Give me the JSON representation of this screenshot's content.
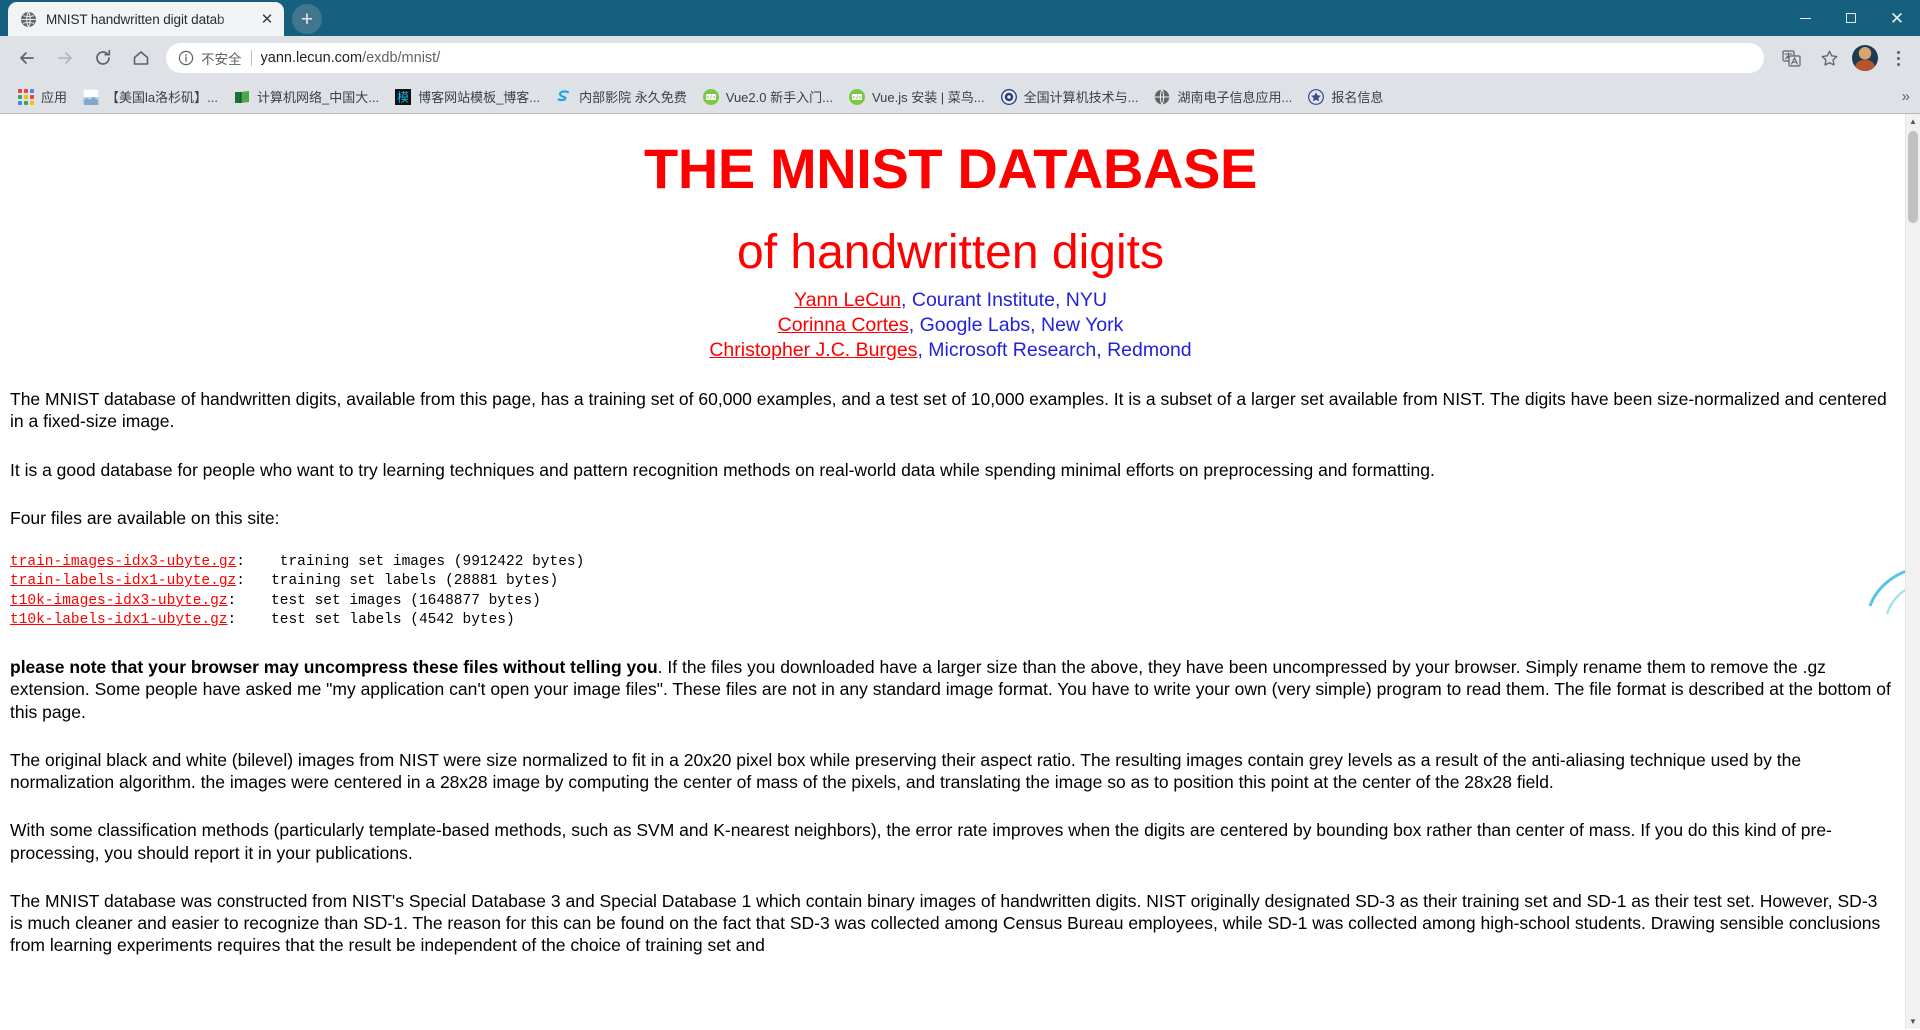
{
  "window": {
    "minimize_label": "Minimize",
    "maximize_label": "Maximize",
    "close_label": "Close"
  },
  "tab": {
    "title": "MNIST handwritten digit datab",
    "favicon_name": "globe-icon",
    "close_label": "✕",
    "newtab_label": "+"
  },
  "toolbar": {
    "back_label": "←",
    "forward_label": "→",
    "reload_label": "⟳",
    "home_label": "⌂",
    "security_text": "不安全",
    "url_prefix": "yann.lecun.com",
    "url_suffix": "/exdb/mnist/",
    "translate_label": "translate-icon",
    "bookmark_star_label": "☆",
    "menu_label": "⋮"
  },
  "bookmarks": {
    "apps_label": "应用",
    "overflow_label": "»",
    "items": [
      {
        "label": "【美国la洛杉矶】...",
        "icon": "photo-icon",
        "color": "#cfe2f3"
      },
      {
        "label": "计算机网络_中国大...",
        "icon": "book-icon",
        "color": "#2f9e44"
      },
      {
        "label": "博客网站模板_博客...",
        "icon": "mo-icon",
        "color": "#14a0d6"
      },
      {
        "label": "内部影院 永久免费",
        "icon": "s-icon",
        "color": "#1aa3e8"
      },
      {
        "label": "Vue2.0 新手入门...",
        "icon": "code-icon",
        "color": "#7ac943"
      },
      {
        "label": "Vue.js 安装 | 菜鸟...",
        "icon": "code-icon",
        "color": "#7ac943"
      },
      {
        "label": "全国计算机技术与...",
        "icon": "seal-icon",
        "color": "#1f3a93"
      },
      {
        "label": "湖南电子信息应用...",
        "icon": "globe-icon",
        "color": "#5f6368"
      },
      {
        "label": "报名信息",
        "icon": "emblem-icon",
        "color": "#3b4a8c"
      }
    ]
  },
  "content": {
    "title": "THE MNIST DATABASE",
    "subtitle": "of handwritten digits",
    "authors": [
      {
        "name": "Yann LeCun",
        "affiliation": ", Courant Institute, NYU",
        "link": true
      },
      {
        "name": "Corinna Cortes",
        "affiliation": ", Google Labs, New York",
        "link": true
      },
      {
        "name": "Christopher J.C. Burges",
        "affiliation": ", Microsoft Research, Redmond",
        "link": true
      }
    ],
    "paragraphs": [
      "The MNIST database of handwritten digits, available from this page, has a training set of 60,000 examples, and a test set of 10,000 examples. It is a subset of a larger set available from NIST. The digits have been size-normalized and centered in a fixed-size image.",
      "It is a good database for people who want to try learning techniques and pattern recognition methods on real-world data while spending minimal efforts on preprocessing and formatting.",
      "Four files are available on this site:"
    ],
    "files": [
      {
        "name": "train-images-idx3-ubyte.gz",
        "desc": "training set images (9912422 bytes)"
      },
      {
        "name": "train-labels-idx1-ubyte.gz",
        "desc": "training set labels (28881 bytes)"
      },
      {
        "name": "t10k-images-idx3-ubyte.gz",
        "desc": " test set images (1648877 bytes)"
      },
      {
        "name": "t10k-labels-idx1-ubyte.gz",
        "desc": " test set labels (4542 bytes)"
      }
    ],
    "note_bold": "please note that your browser may uncompress these files without telling you",
    "note_rest": ". If the files you downloaded have a larger size than the above, they have been uncompressed by your browser. Simply rename them to remove the .gz extension. Some people have asked me \"my application can't open your image files\". These files are not in any standard image format. You have to write your own (very simple) program to read them. The file format is described at the bottom of this page.",
    "paragraphs2": [
      "The original black and white (bilevel) images from NIST were size normalized to fit in a 20x20 pixel box while preserving their aspect ratio. The resulting images contain grey levels as a result of the anti-aliasing technique used by the normalization algorithm. the images were centered in a 28x28 image by computing the center of mass of the pixels, and translating the image so as to position this point at the center of the 28x28 field.",
      "With some classification methods (particularly template-based methods, such as SVM and K-nearest neighbors), the error rate improves when the digits are centered by bounding box rather than center of mass. If you do this kind of pre-processing, you should report it in your publications.",
      "The MNIST database was constructed from NIST's Special Database 3 and Special Database 1 which contain binary images of handwritten digits. NIST originally designated SD-3 as their training set and SD-1 as their test set. However, SD-3 is much cleaner and easier to recognize than SD-1. The reason for this can be found on the fact that SD-3 was collected among Census Bureau employees, while SD-1 was collected among high-school students. Drawing sensible conclusions from learning experiments requires that the result be independent of the choice of training set and"
    ]
  },
  "colors": {
    "title_red": "#ff0000",
    "link_blue": "#2222dd",
    "chrome_frame": "#15607f",
    "toolbar_bg": "#dee1e6"
  },
  "scrollbar": {
    "up_label": "▲",
    "down_label": "▼"
  }
}
